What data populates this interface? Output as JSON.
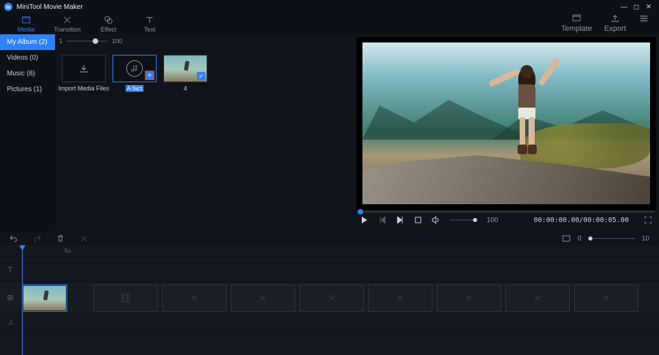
{
  "titlebar": {
    "app_name": "MiniTool Movie Maker"
  },
  "toolbar": {
    "tabs": [
      {
        "label": "Media"
      },
      {
        "label": "Transition"
      },
      {
        "label": "Effect"
      },
      {
        "label": "Text"
      }
    ],
    "right": [
      {
        "label": "Template"
      },
      {
        "label": "Export"
      }
    ]
  },
  "sidebar": {
    "items": [
      {
        "label": "My Album (2)"
      },
      {
        "label": "Videos (0)"
      },
      {
        "label": "Music (6)"
      },
      {
        "label": "Pictures (1)"
      }
    ]
  },
  "thumb_slider": {
    "min": "1",
    "max": "100"
  },
  "album": {
    "import_label": "Import Media Files",
    "items": [
      {
        "caption": "A fact"
      },
      {
        "caption": "4"
      }
    ]
  },
  "preview": {
    "volume": "100",
    "time": "00:00:00.00/00:00:05.00"
  },
  "edit_tools": {
    "zoom_min": "0",
    "zoom_max": "10"
  },
  "timeline": {
    "ruler_tick": "5s"
  }
}
